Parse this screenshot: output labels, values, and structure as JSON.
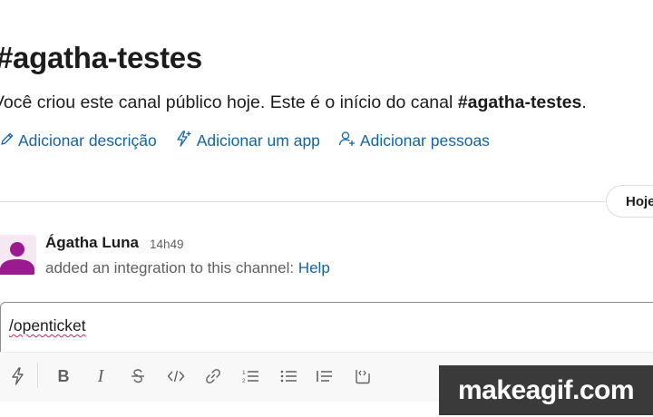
{
  "channel": {
    "title": "#agatha-testes",
    "intro_prefix": "Você criou este canal público hoje. Este é o início do canal",
    "intro_channel": "#agatha-testes",
    "intro_suffix": "."
  },
  "actions": [
    {
      "label": "Adicionar descrição",
      "icon": "pencil-icon"
    },
    {
      "label": "Adicionar um app",
      "icon": "bolt-plus-icon"
    },
    {
      "label": "Adicionar pessoas",
      "icon": "add-person-icon"
    }
  ],
  "date_divider": {
    "label": "Hoje"
  },
  "message": {
    "author": "Ágatha Luna",
    "time": "14h49",
    "text_prefix": "added an integration to this channel:",
    "link": "Help"
  },
  "composer": {
    "value": "/openticket"
  },
  "toolbar": [
    {
      "icon": "shortcuts-bolt-icon"
    },
    {
      "icon": "bold-icon"
    },
    {
      "icon": "italic-icon"
    },
    {
      "icon": "strikethrough-icon"
    },
    {
      "icon": "code-icon"
    },
    {
      "icon": "link-icon"
    },
    {
      "icon": "ordered-list-icon"
    },
    {
      "icon": "bulleted-list-icon"
    },
    {
      "icon": "blockquote-icon"
    },
    {
      "icon": "code-block-icon"
    }
  ],
  "watermark": {
    "text": "makeagif.com"
  },
  "colors": {
    "link": "#1264a3",
    "text": "#1d1c1d",
    "muted": "#616061",
    "avatar": "#9c1a8f"
  }
}
